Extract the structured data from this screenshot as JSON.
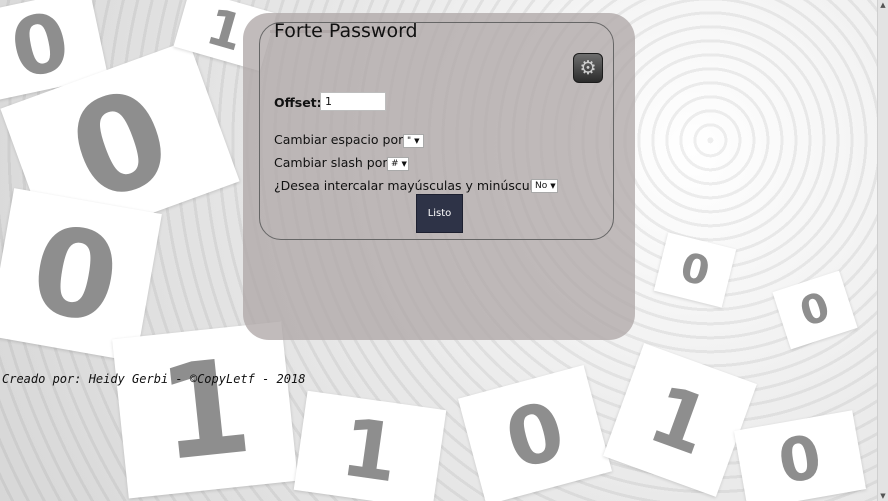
{
  "form": {
    "title": "Forte Password",
    "offset_label": "Offset:",
    "offset_value": "1",
    "space_label": "Cambiar espacio por:",
    "space_value": "\"",
    "slash_label": "Cambiar slash por:",
    "slash_value": "#",
    "case_label": "¿Desea intercalar mayúsculas y minúsculas?",
    "case_value": "No",
    "submit_label": "Listo",
    "settings_icon": "gear-icon"
  },
  "footer": {
    "text": "Creado por: Heidy Gerbi - ©CopyLetf - 2018"
  },
  "colors": {
    "panel": "#b0a8a8",
    "button": "#2e3347"
  }
}
